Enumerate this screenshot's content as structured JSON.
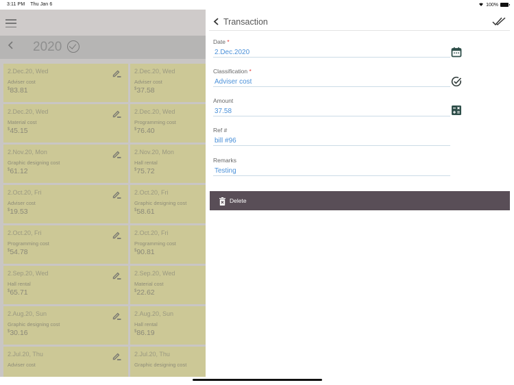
{
  "status_bar": {
    "time": "3:11 PM",
    "date": "Thu Jan 6",
    "battery": "100%"
  },
  "left_panel": {
    "menu_icon": "hamburger-menu-icon",
    "year": "2020",
    "currency_symbol": "$",
    "cards": [
      {
        "date": "2.Dec.20, Wed",
        "type": "Adviser cost",
        "amount": "83.81",
        "editable": true
      },
      {
        "date": "2.Dec.20, Wed",
        "type": "Adviser cost",
        "amount": "37.58",
        "editable": false
      },
      {
        "date": "2.Dec.20, Wed",
        "type": "Material cost",
        "amount": "45.15",
        "editable": true
      },
      {
        "date": "2.Dec.20, Wed",
        "type": "Programming cost",
        "amount": "76.40",
        "editable": false
      },
      {
        "date": "2.Nov.20, Mon",
        "type": "Graphic designing cost",
        "amount": "61.12",
        "editable": true
      },
      {
        "date": "2.Nov.20, Mon",
        "type": "Hall rental",
        "amount": "75.72",
        "editable": false
      },
      {
        "date": "2.Oct.20, Fri",
        "type": "Adviser cost",
        "amount": "19.53",
        "editable": true
      },
      {
        "date": "2.Oct.20, Fri",
        "type": "Graphic designing cost",
        "amount": "58.61",
        "editable": false
      },
      {
        "date": "2.Oct.20, Fri",
        "type": "Programming cost",
        "amount": "54.78",
        "editable": true
      },
      {
        "date": "2.Oct.20, Fri",
        "type": "Programming cost",
        "amount": "90.81",
        "editable": false
      },
      {
        "date": "2.Sep.20, Wed",
        "type": "Hall rental",
        "amount": "65.71",
        "editable": true
      },
      {
        "date": "2.Sep.20, Wed",
        "type": "Material cost",
        "amount": "22.62",
        "editable": false
      },
      {
        "date": "2.Aug.20, Sun",
        "type": "Graphic designing cost",
        "amount": "30.16",
        "editable": true
      },
      {
        "date": "2.Aug.20, Sun",
        "type": "Hall rental",
        "amount": "86.19",
        "editable": false
      },
      {
        "date": "2.Jul.20, Thu",
        "type": "Adviser cost",
        "amount": "",
        "editable": true
      },
      {
        "date": "2.Jul.20, Thu",
        "type": "Graphic designing cost",
        "amount": "",
        "editable": false
      }
    ]
  },
  "transaction": {
    "title": "Transaction",
    "fields": {
      "date": {
        "label": "Date",
        "required_mark": "*",
        "value": "2.Dec.2020",
        "icon": "calendar-icon"
      },
      "classification": {
        "label": "Classification",
        "required_mark": "*",
        "value": "Adviser cost",
        "icon": "check-circle-icon"
      },
      "amount": {
        "label": "Amount",
        "value": "37.58",
        "icon": "calculator-icon"
      },
      "ref": {
        "label": "Ref #",
        "value": "bill #96"
      },
      "remarks": {
        "label": "Remarks",
        "value": "Testing"
      }
    },
    "delete_label": "Delete"
  },
  "colors": {
    "accent_text": "#4a90d9",
    "card_bg": "#ccc896",
    "delete_bar": "#594e57",
    "required": "#e53935"
  }
}
